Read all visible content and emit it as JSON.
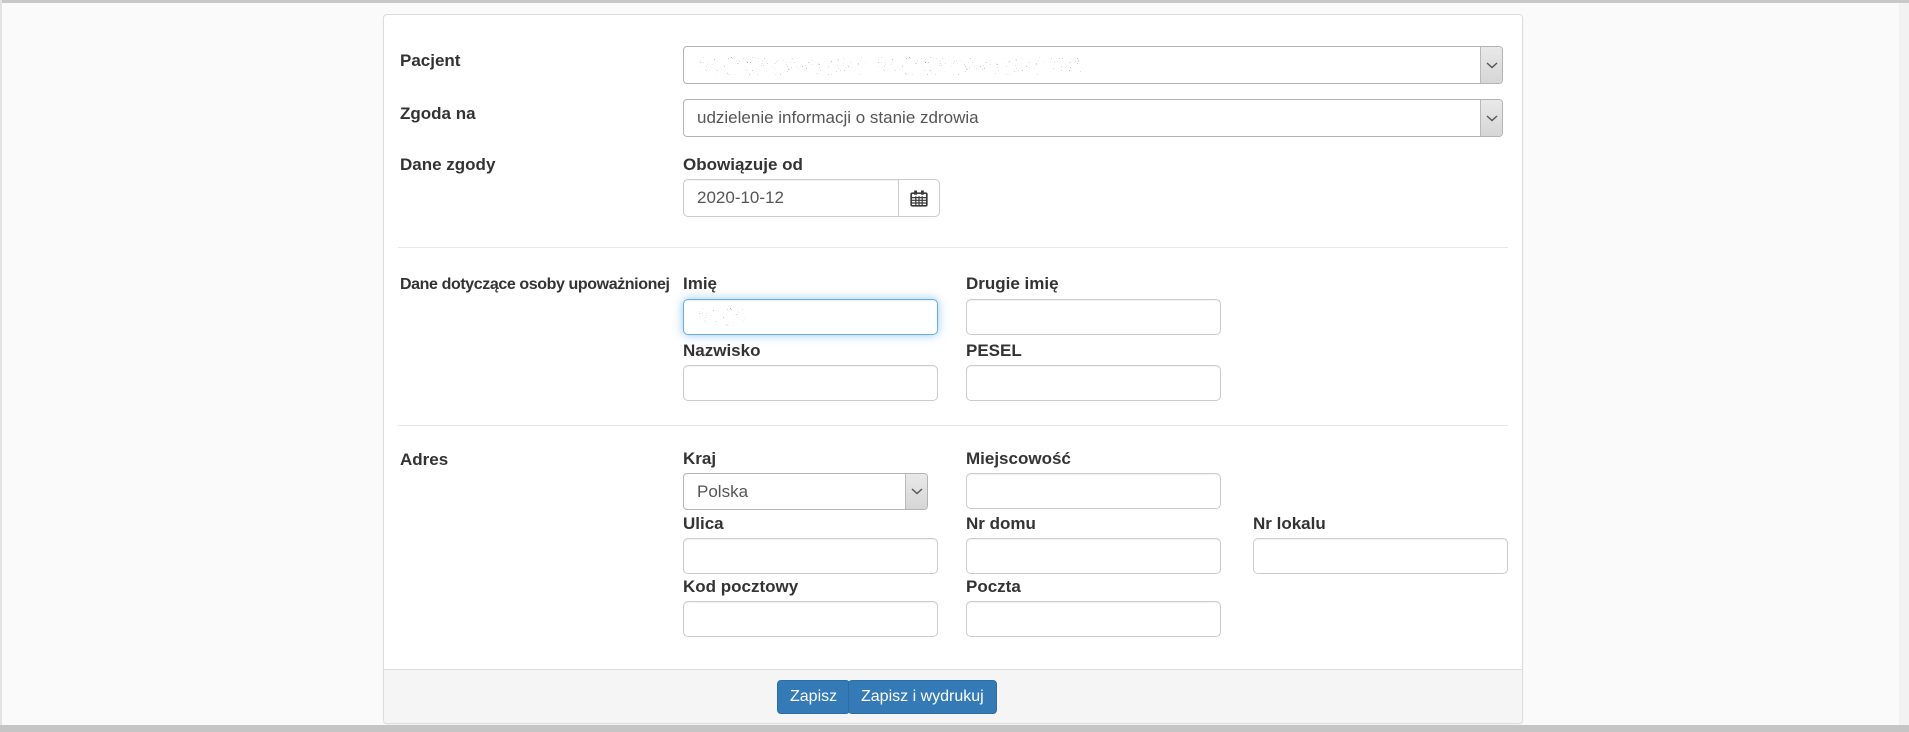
{
  "form": {
    "pacjent_label": "Pacjent",
    "pacjent_value_redacted": true,
    "zgoda_label": "Zgoda na",
    "zgoda_value": "udzielenie informacji o stanie zdrowia",
    "dane_zgody_label": "Dane zgody",
    "obowiazuje_label": "Obowiązuje od",
    "obowiazuje_value": "2020-10-12",
    "osoba_section_label": "Dane dotyczące osoby upoważnionej",
    "imie_label": "Imię",
    "imie_value_redacted": true,
    "drugie_imie_label": "Drugie imię",
    "nazwisko_label": "Nazwisko",
    "pesel_label": "PESEL",
    "adres_section_label": "Adres",
    "kraj_label": "Kraj",
    "kraj_value": "Polska",
    "miejscowosc_label": "Miejscowość",
    "ulica_label": "Ulica",
    "nr_domu_label": "Nr domu",
    "nr_lokalu_label": "Nr lokalu",
    "kod_pocztowy_label": "Kod pocztowy",
    "poczta_label": "Poczta"
  },
  "footer": {
    "save_label": "Zapisz",
    "save_print_label": "Zapisz i wydrukuj"
  },
  "icons": {
    "calendar": "calendar-icon",
    "select_chevron": "chevron-down-icon"
  },
  "colors": {
    "primary_button": "#337ab7",
    "primary_button_border": "#2e6da4",
    "focus_border": "#66afe9",
    "panel_border": "#dddddd",
    "footer_bg": "#f5f5f5",
    "page_bg": "#fafafa"
  }
}
